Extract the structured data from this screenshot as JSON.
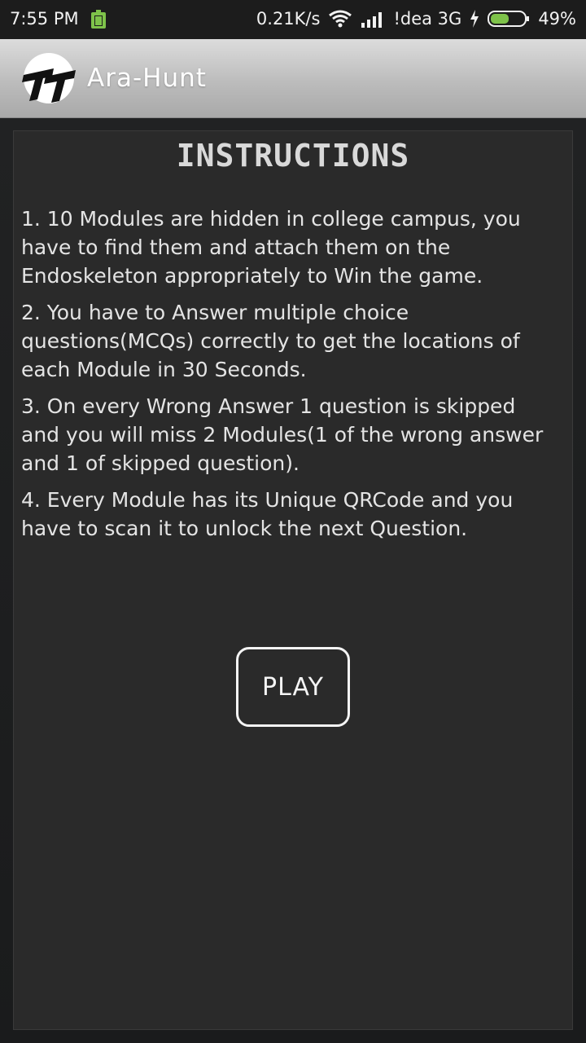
{
  "status_bar": {
    "time": "7:55 PM",
    "network_speed": "0.21K/s",
    "carrier": "!dea 3G",
    "battery": "49%"
  },
  "app_bar": {
    "title": "Ara-Hunt",
    "logo_icon": "tt-logo-icon"
  },
  "main": {
    "heading": "INSTRUCTIONS",
    "instructions": [
      "1. 10 Modules are hidden in college campus, you have to find them and attach them on the Endoskeleton appropriately to Win the game.",
      "2. You have to Answer multiple choice questions(MCQs) correctly to get the locations of each Module in 30 Seconds.",
      "3. On every Wrong Answer 1 question is skipped and you will miss 2 Modules(1 of the wrong answer and 1 of skipped question).",
      "4. Every Module has its Unique QRCode and you have to scan it to unlock the next Question."
    ],
    "play_label": "PLAY"
  },
  "colors": {
    "panel_bg": "#2a2a2a",
    "text": "#e4e4e4",
    "app_bar": "#c4c4c4"
  }
}
